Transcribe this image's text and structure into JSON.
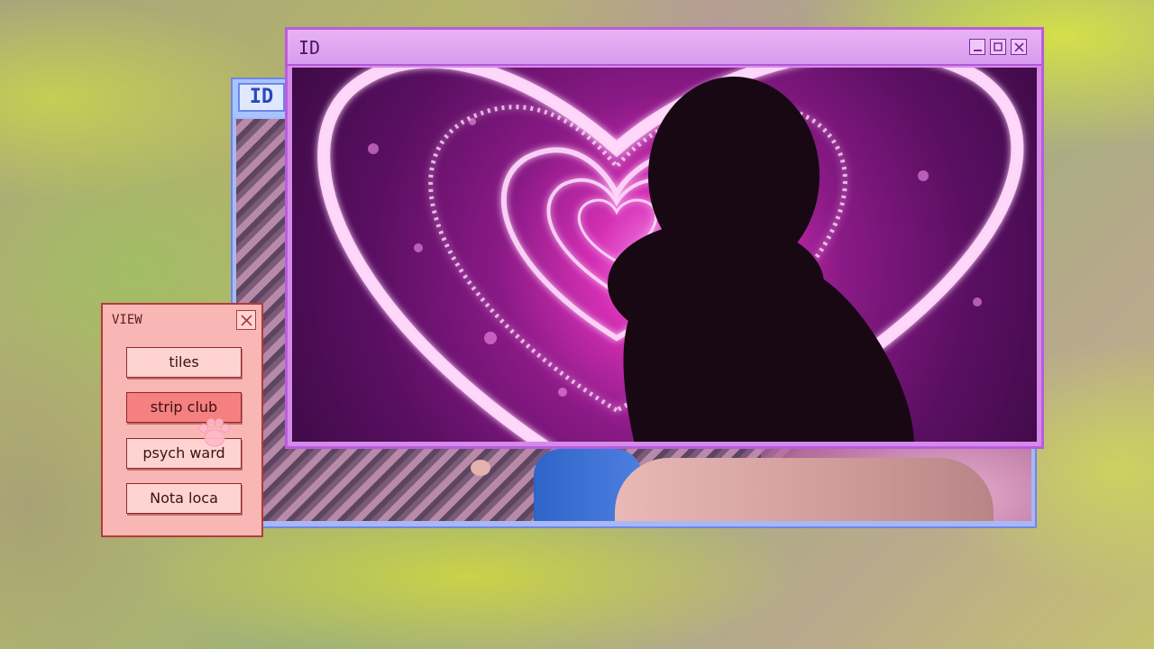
{
  "back_window": {
    "title": "ID"
  },
  "front_window": {
    "title": "ID",
    "controls": [
      "minimize-icon",
      "maximize-icon",
      "close-icon"
    ]
  },
  "view_panel": {
    "title": "VIEW",
    "close_icon": "close-icon",
    "buttons": [
      {
        "label": "tiles",
        "active": false
      },
      {
        "label": "strip club",
        "active": true
      },
      {
        "label": "psych ward",
        "active": false
      },
      {
        "label": "Nota loca",
        "active": false
      }
    ]
  },
  "cursor": {
    "icon": "paw-cursor-icon"
  },
  "colors": {
    "front_window": "#d48be8",
    "back_window": "#a9b8f4",
    "view_panel": "#f8b7b4",
    "active_button": "#f4807f"
  }
}
